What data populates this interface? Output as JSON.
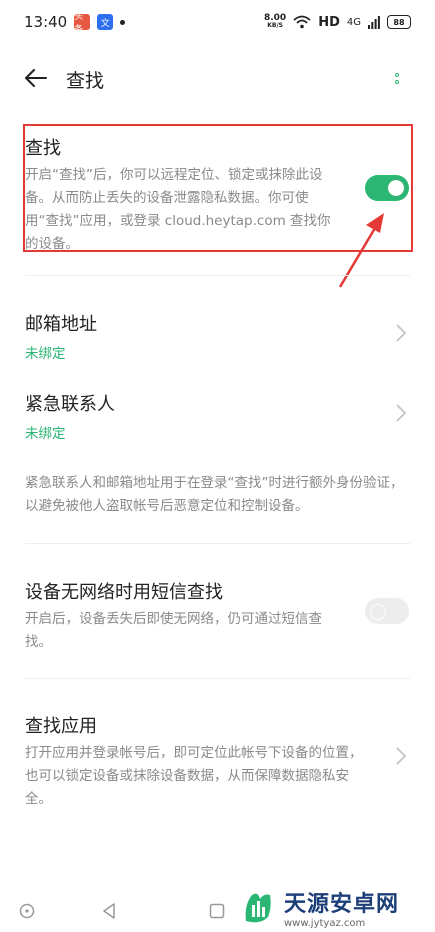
{
  "status_bar": {
    "time": "13:40",
    "app_icon_1": "头条",
    "app_icon_2": "文",
    "net_speed_value": "8.00",
    "net_speed_unit": "KB/S",
    "hd_label": "HD",
    "signal_label": "4G",
    "battery": "88"
  },
  "header": {
    "title": "查找"
  },
  "find": {
    "title": "查找",
    "description": "开启“查找”后，你可以远程定位、锁定或抹除此设备。从而防止丢失的设备泄露隐私数据。你可使用“查找”应用，或登录 cloud.heytap.com 查找你的设备。",
    "toggle_on": true
  },
  "email": {
    "title": "邮箱地址",
    "status": "未绑定"
  },
  "emergency": {
    "title": "紧急联系人",
    "status": "未绑定"
  },
  "info_note": "紧急联系人和邮箱地址用于在登录“查找”时进行额外身份验证，以避免被他人盗取帐号后恶意定位和控制设备。",
  "sms_find": {
    "title": "设备无网络时用短信查找",
    "description": "开启后，设备丢失后即使无网络，仍可通过短信查找。",
    "toggle_on": false
  },
  "find_app": {
    "title": "查找应用",
    "description": "打开应用并登录帐号后，即可定位此帐号下设备的位置，也可以锁定设备或抹除设备数据，从而保障数据隐私安全。"
  },
  "watermark": {
    "name": "天源安卓网",
    "url": "www.jytyaz.com"
  },
  "colors": {
    "accent": "#2bb673",
    "highlight": "#e53935",
    "text_secondary": "#8a8a8a"
  }
}
